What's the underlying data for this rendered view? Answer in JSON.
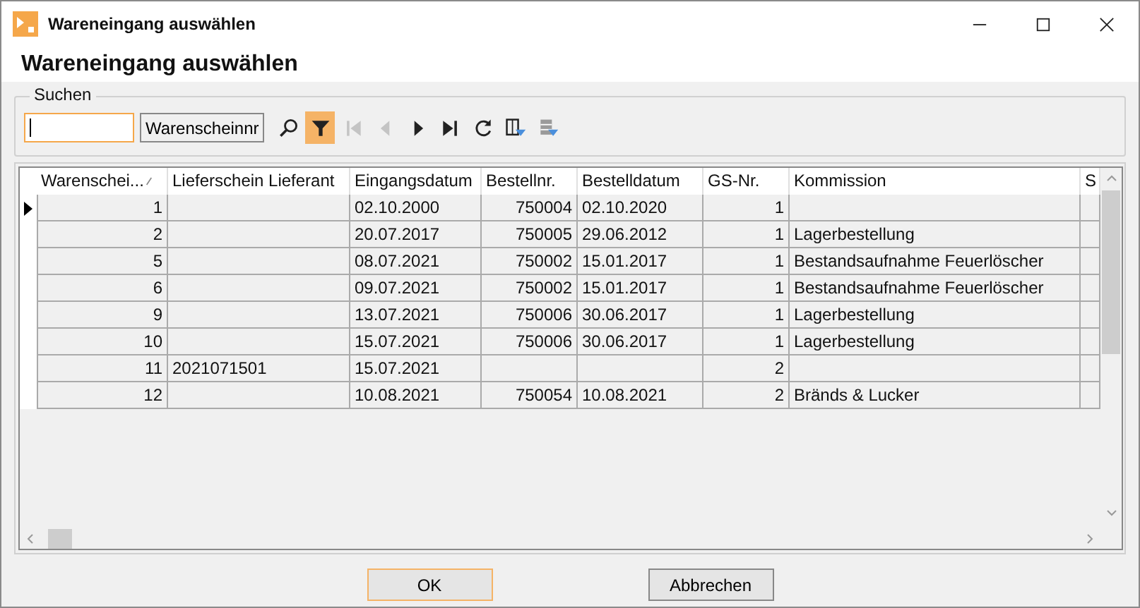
{
  "window": {
    "title": "Wareneingang auswählen"
  },
  "heading": "Wareneingang auswählen",
  "search": {
    "group_label": "Suchen",
    "focused": true,
    "field_button": "Warenscheinnr",
    "tools": [
      {
        "kind": "search",
        "disabled": false,
        "active": false
      },
      {
        "kind": "filter",
        "disabled": false,
        "active": true
      },
      {
        "kind": "first",
        "disabled": true,
        "active": false
      },
      {
        "kind": "prev",
        "disabled": true,
        "active": false
      },
      {
        "kind": "next",
        "disabled": false,
        "active": false
      },
      {
        "kind": "last",
        "disabled": false,
        "active": false
      },
      {
        "kind": "refresh",
        "disabled": false,
        "active": false
      },
      {
        "kind": "column-filter",
        "disabled": false,
        "active": false
      },
      {
        "kind": "row-filter",
        "disabled": true,
        "active": false
      }
    ]
  },
  "table": {
    "columns": [
      {
        "label": "Warenschei...",
        "kind": "number",
        "sorted": true
      },
      {
        "label": "Lieferschein Lieferant",
        "kind": "text",
        "sorted": false
      },
      {
        "label": "Eingangsdatum",
        "kind": "text",
        "sorted": false
      },
      {
        "label": "Bestellnr.",
        "kind": "number",
        "sorted": false
      },
      {
        "label": "Bestelldatum",
        "kind": "text",
        "sorted": false
      },
      {
        "label": "GS-Nr.",
        "kind": "number",
        "sorted": false
      },
      {
        "label": "Kommission",
        "kind": "text",
        "sorted": false
      },
      {
        "label": "S",
        "kind": "text",
        "sorted": false
      }
    ],
    "rows": [
      {
        "selected": true,
        "cells": [
          "1",
          "",
          "02.10.2000",
          "750004",
          "02.10.2020",
          "1",
          "",
          ""
        ]
      },
      {
        "selected": false,
        "cells": [
          "2",
          "",
          "20.07.2017",
          "750005",
          "29.06.2012",
          "1",
          "Lagerbestellung",
          ""
        ]
      },
      {
        "selected": false,
        "cells": [
          "5",
          "",
          "08.07.2021",
          "750002",
          "15.01.2017",
          "1",
          "Bestandsaufnahme Feuerlöscher",
          ""
        ]
      },
      {
        "selected": false,
        "cells": [
          "6",
          "",
          "09.07.2021",
          "750002",
          "15.01.2017",
          "1",
          "Bestandsaufnahme Feuerlöscher",
          ""
        ]
      },
      {
        "selected": false,
        "cells": [
          "9",
          "",
          "13.07.2021",
          "750006",
          "30.06.2017",
          "1",
          "Lagerbestellung",
          ""
        ]
      },
      {
        "selected": false,
        "cells": [
          "10",
          "",
          "15.07.2021",
          "750006",
          "30.06.2017",
          "1",
          "Lagerbestellung",
          ""
        ]
      },
      {
        "selected": false,
        "cells": [
          "11",
          "2021071501",
          "15.07.2021",
          "",
          "",
          "2",
          "",
          ""
        ]
      },
      {
        "selected": false,
        "cells": [
          "12",
          "",
          "10.08.2021",
          "750054",
          "10.08.2021",
          "2",
          "Bränds & Lucker",
          ""
        ]
      }
    ]
  },
  "buttons": [
    {
      "label": "OK",
      "default": true
    },
    {
      "label": "Abbrechen",
      "default": false
    }
  ]
}
